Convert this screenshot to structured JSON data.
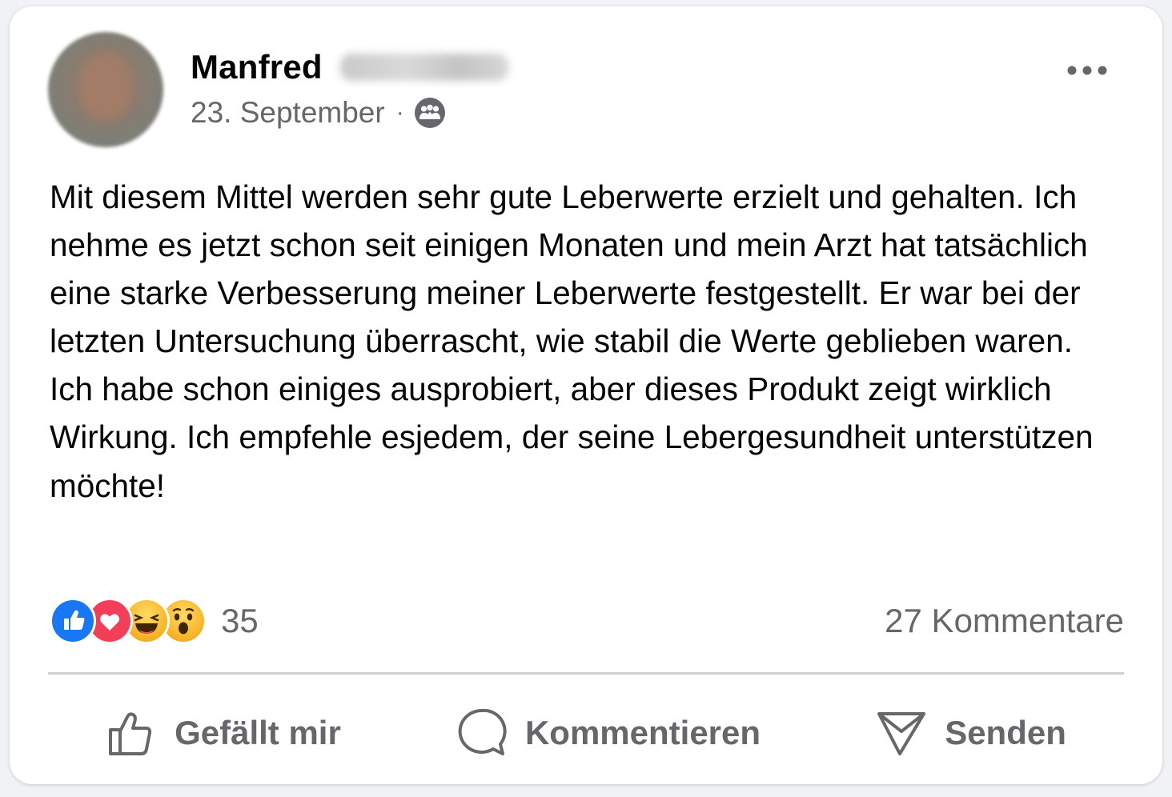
{
  "post": {
    "author_first_name": "Manfred",
    "date": "23. September",
    "separator": "·",
    "audience_icon": "group-icon",
    "more_icon": "more-horizontal-icon",
    "text": "Mit diesem Mittel werden sehr gute Leberwerte erzielt und gehalten. Ich nehme es jetzt schon seit einigen Monaten und mein Arzt hat tatsächlich eine starke Verbesserung meiner Leberwerte festgestellt. Er war bei der letzten Untersuchung überrascht, wie stabil die Werte geblieben waren. Ich habe schon einiges ausprobiert, aber dieses Produkt zeigt wirklich Wirkung. Ich empfehle esjedem, der seine Lebergesundheit unterstützen möchte!"
  },
  "stats": {
    "reactions": [
      "like",
      "love",
      "haha",
      "wow"
    ],
    "reaction_count": "35",
    "comments": "27 Kommentare"
  },
  "actions": {
    "like_label": "Gefällt mir",
    "comment_label": "Kommentieren",
    "send_label": "Senden"
  },
  "colors": {
    "like_blue": "#1877f2",
    "love_red": "#f33e58",
    "emoji_yellow": "#f7b125",
    "secondary_text": "#65676b"
  }
}
